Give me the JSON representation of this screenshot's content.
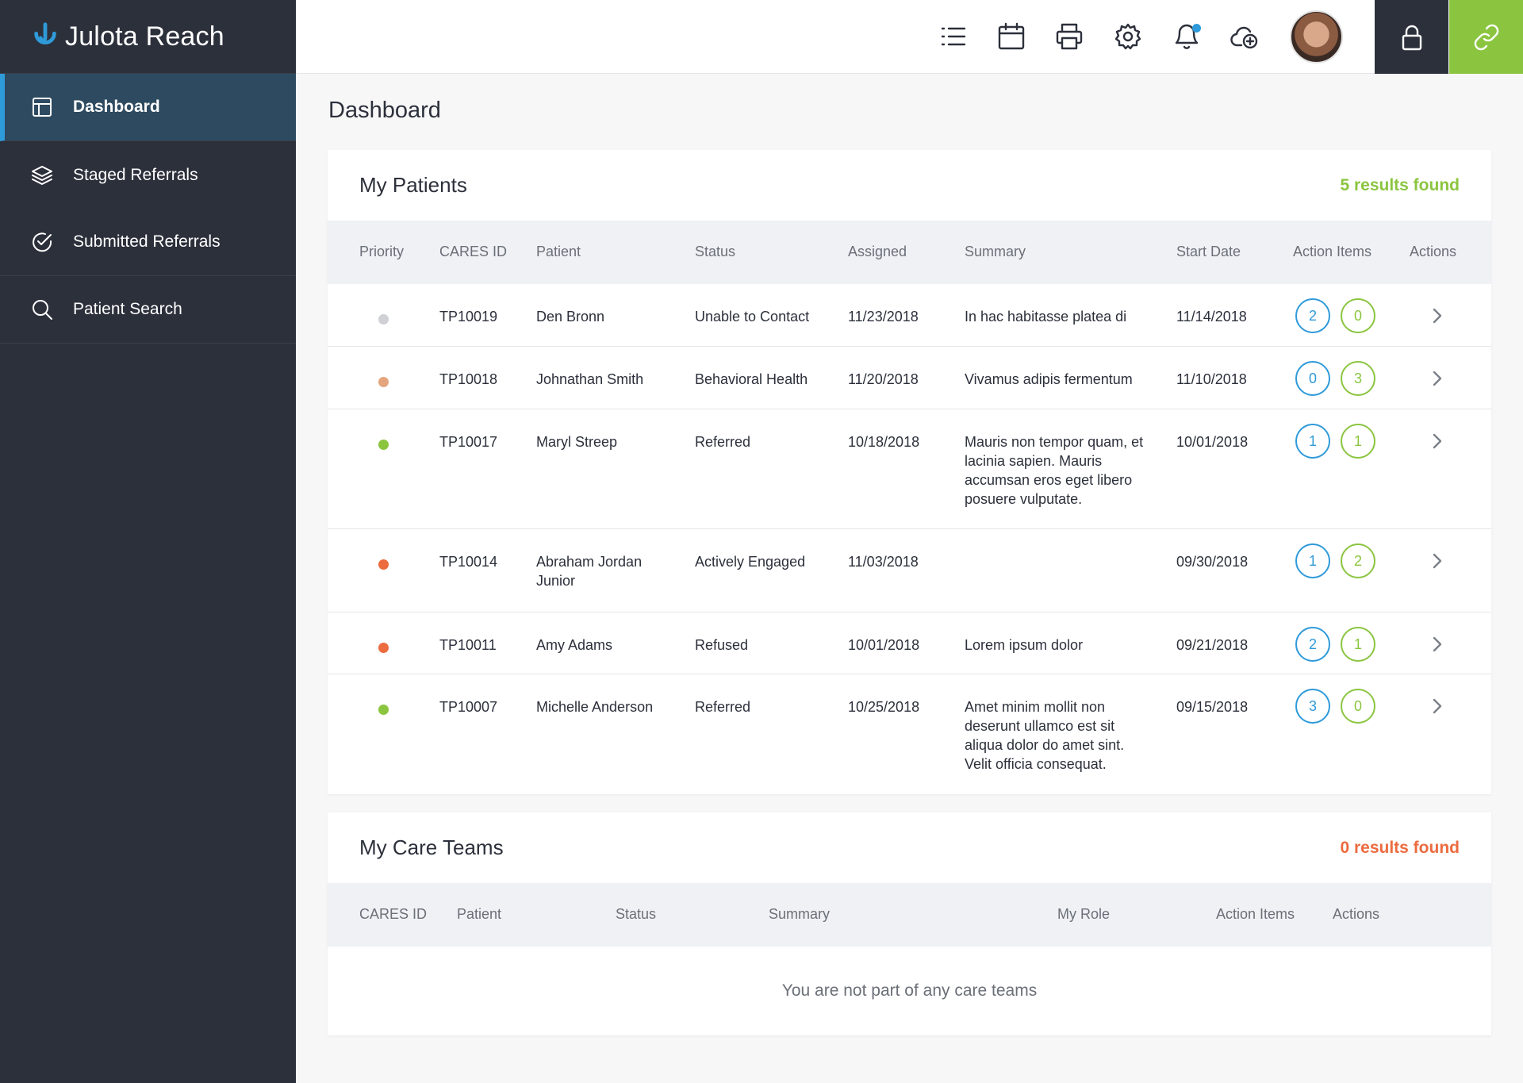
{
  "app": {
    "brand_name": "Julota Reach"
  },
  "sidebar": {
    "items": [
      {
        "label": "Dashboard",
        "icon": "dashboard-icon",
        "active": true
      },
      {
        "label": "Staged Referrals",
        "icon": "layers-icon",
        "active": false
      },
      {
        "label": "Submitted Referrals",
        "icon": "check-circle-icon",
        "active": false
      },
      {
        "label": "Patient Search",
        "icon": "search-icon",
        "active": false
      }
    ]
  },
  "topbar": {
    "icons": [
      "list-icon",
      "calendar-icon",
      "printer-icon",
      "gear-icon",
      "bell-icon",
      "cloud-add-icon"
    ],
    "notification_dot_color": "#2f9ad9",
    "lock_button_color": "#2c303b",
    "link_button_color": "#8bc540"
  },
  "page": {
    "title": "Dashboard"
  },
  "patients": {
    "title": "My Patients",
    "results": "5 results found",
    "columns": {
      "priority": "Priority",
      "cares_id": "CARES ID",
      "patient": "Patient",
      "status": "Status",
      "assigned": "Assigned",
      "summary": "Summary",
      "start_date": "Start Date",
      "action_items": "Action Items",
      "actions": "Actions"
    },
    "rows": [
      {
        "priority_color": "#cfd1d5",
        "cares_id": "TP10019",
        "patient": "Den Bronn",
        "status": "Unable to Contact",
        "assigned": "11/23/2018",
        "summary": "In hac habitasse platea di",
        "start_date": "11/14/2018",
        "badge_blue": "2",
        "badge_green": "0"
      },
      {
        "priority_color": "#e4a57e",
        "cares_id": "TP10018",
        "patient": "Johnathan Smith",
        "status": "Behavioral Health",
        "assigned": "11/20/2018",
        "summary": "Vivamus adipis fermentum",
        "start_date": "11/10/2018",
        "badge_blue": "0",
        "badge_green": "3"
      },
      {
        "priority_color": "#8bc540",
        "cares_id": "TP10017",
        "patient": "Maryl Streep",
        "status": "Referred",
        "assigned": "10/18/2018",
        "summary": "Mauris non tempor quam, et lacinia sapien. Mauris accumsan eros eget libero posuere vulputate.",
        "start_date": "10/01/2018",
        "badge_blue": "1",
        "badge_green": "1"
      },
      {
        "priority_color": "#ec6b3f",
        "cares_id": "TP10014",
        "patient": "Abraham Jordan Junior",
        "status": "Actively Engaged",
        "assigned": "11/03/2018",
        "summary": "",
        "start_date": "09/30/2018",
        "badge_blue": "1",
        "badge_green": "2"
      },
      {
        "priority_color": "#ec6b3f",
        "cares_id": "TP10011",
        "patient": "Amy Adams",
        "status": "Refused",
        "assigned": "10/01/2018",
        "summary": "Lorem ipsum dolor",
        "start_date": "09/21/2018",
        "badge_blue": "2",
        "badge_green": "1"
      },
      {
        "priority_color": "#8bc540",
        "cares_id": "TP10007",
        "patient": "Michelle Anderson",
        "status": "Referred",
        "assigned": "10/25/2018",
        "summary": "Amet minim mollit non deserunt ullamco est sit aliqua dolor do amet sint. Velit officia consequat.",
        "start_date": "09/15/2018",
        "badge_blue": "3",
        "badge_green": "0"
      }
    ]
  },
  "care_teams": {
    "title": "My Care Teams",
    "results": "0 results found",
    "columns": {
      "cares_id": "CARES ID",
      "patient": "Patient",
      "status": "Status",
      "summary": "Summary",
      "my_role": "My Role",
      "action_items": "Action Items",
      "actions": "Actions"
    },
    "empty_message": "You are not part of any care teams"
  }
}
